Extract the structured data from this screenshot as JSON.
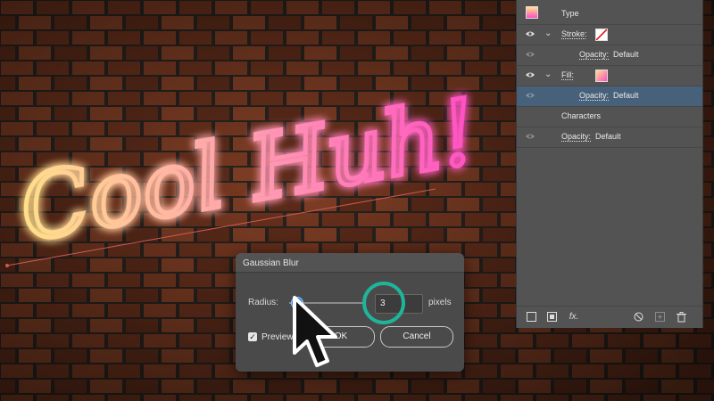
{
  "neon_sign": {
    "text": "Cool Huh!"
  },
  "appearance_panel": {
    "type_label": "Type",
    "rows": [
      {
        "id": "stroke",
        "label": "Stroke:"
      },
      {
        "id": "stroke-opacity",
        "label": "Opacity:",
        "value": "Default"
      },
      {
        "id": "fill",
        "label": "Fill:"
      },
      {
        "id": "fill-opacity",
        "label": "Opacity:",
        "value": "Default"
      },
      {
        "id": "characters",
        "label": "Characters"
      },
      {
        "id": "opacity",
        "label": "Opacity:",
        "value": "Default"
      }
    ],
    "footer_icons": [
      "new-stroke-icon",
      "new-fill-icon",
      "fx-icon",
      "clear-icon",
      "duplicate-icon",
      "trash-icon"
    ],
    "fx_label": "fx."
  },
  "dialog": {
    "title": "Gaussian Blur",
    "radius_label": "Radius:",
    "radius_value": "3",
    "unit_label": "pixels",
    "preview_label": "Preview",
    "preview_checked": true,
    "ok_label": "OK",
    "cancel_label": "Cancel"
  },
  "colors": {
    "panel_bg": "#535353",
    "selected_row": "#48617a",
    "accent_blue": "#1e88e5",
    "focus_ring": "#1fb59a",
    "neon_start": "#ffe08a",
    "neon_end": "#ff4fc4"
  }
}
